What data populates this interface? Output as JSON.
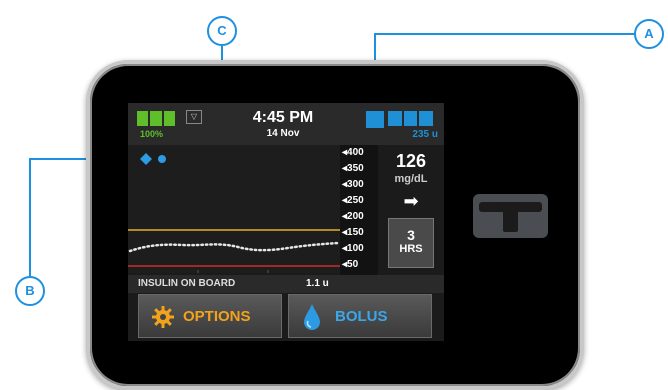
{
  "status": {
    "battery_percent": "100%",
    "time": "4:45 PM",
    "date": "14 Nov",
    "insulin_units": "235 u"
  },
  "graph": {
    "axis_ticks": [
      "400",
      "350",
      "300",
      "250",
      "200",
      "150",
      "100",
      "50"
    ]
  },
  "readout": {
    "glucose_value": "126",
    "glucose_unit": "mg/dL",
    "trend_arrow": "➡",
    "hours_value": "3",
    "hours_label": "HRS"
  },
  "iob": {
    "label": "INSULIN ON BOARD",
    "value": "1.1 u"
  },
  "buttons": {
    "options_label": "OPTIONS",
    "bolus_label": "BOLUS"
  },
  "callouts": {
    "a": "A",
    "b": "B",
    "c": "C"
  },
  "icons": {
    "gear": "gear-icon",
    "drop": "drop-icon",
    "logo": "t-logo"
  },
  "colors": {
    "battery_green": "#5fbf2b",
    "insulin_blue": "#1f8fd6",
    "options_orange": "#f2a31b",
    "callout_blue": "#1e90e0",
    "high_line": "#e3b21c",
    "low_line": "#d22b2b"
  }
}
